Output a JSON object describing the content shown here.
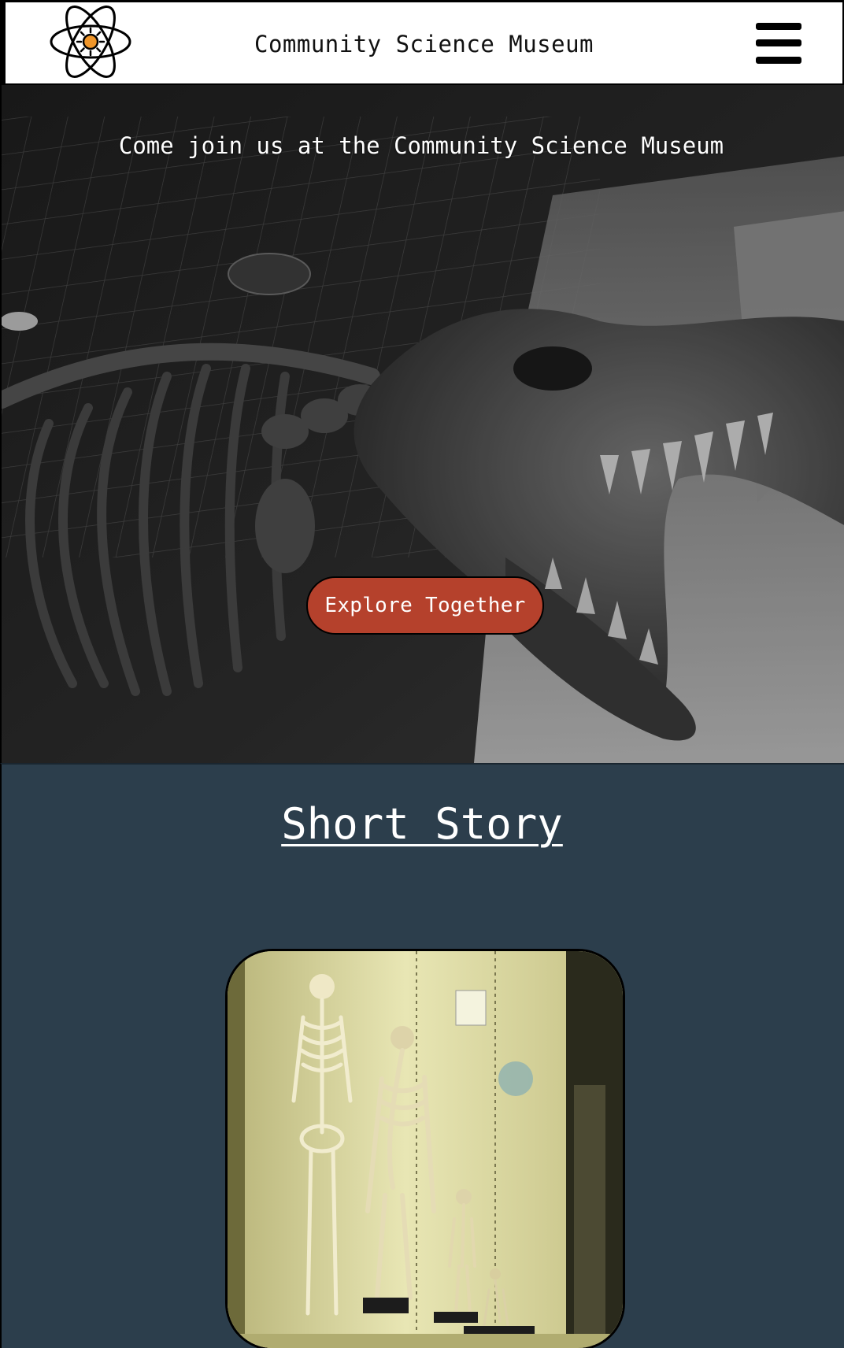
{
  "header": {
    "title": "Community Science Museum",
    "logo_icon": "atom-icon",
    "menu_icon": "hamburger-menu-icon"
  },
  "hero": {
    "tagline": "Come join us at the Community Science Museum",
    "button_label": "Explore Together",
    "button_color": "#b5412c"
  },
  "story": {
    "heading": "Short Story",
    "background_color": "#2c3e4c"
  }
}
